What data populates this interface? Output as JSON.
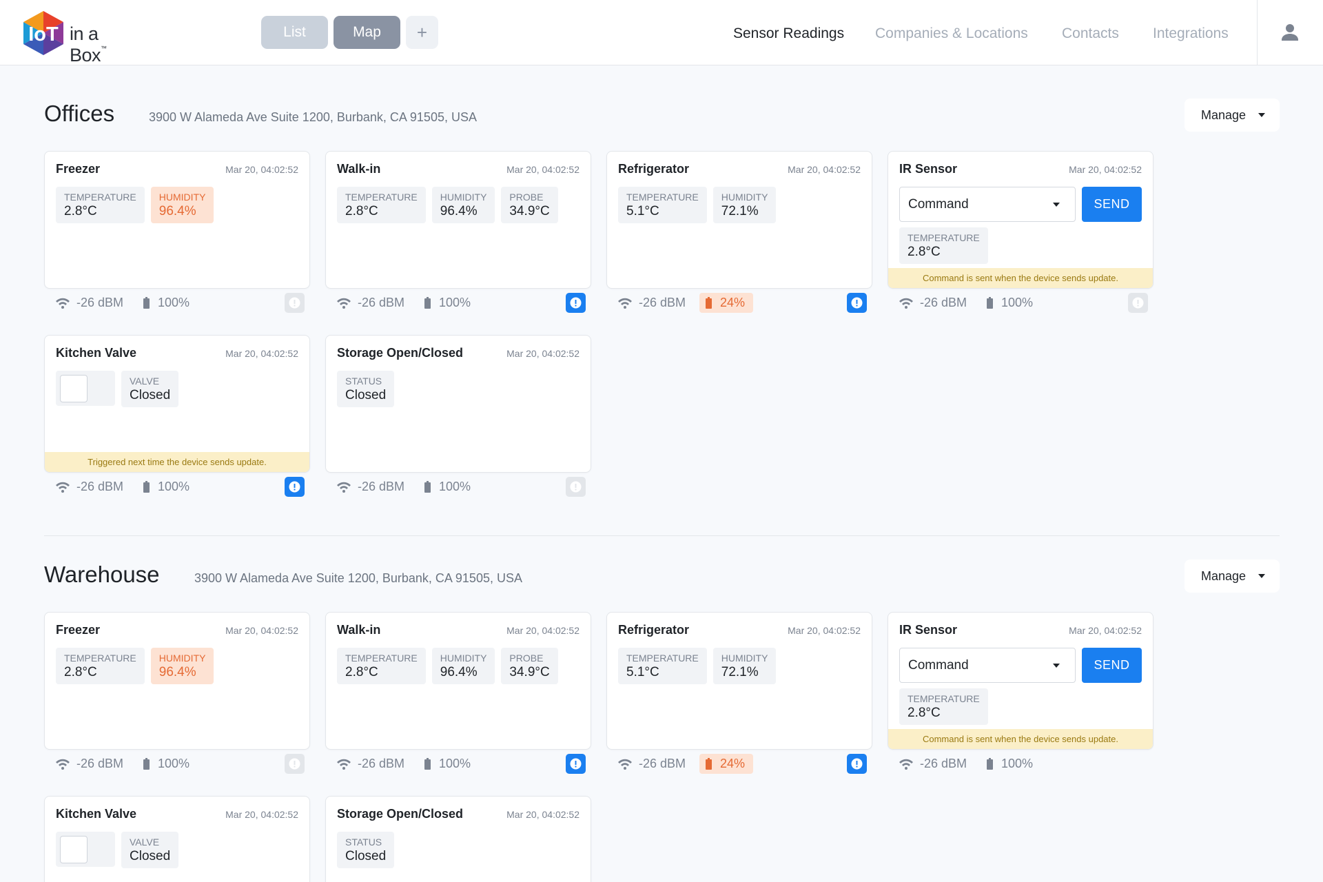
{
  "app": {
    "logo_word": "in a Box",
    "logo_tm": "™"
  },
  "view_toggle": {
    "list": "List",
    "map": "Map",
    "add": "+"
  },
  "nav": [
    "Sensor Readings",
    "Companies & Locations",
    "Contacts",
    "Integrations"
  ],
  "colors": {
    "primary": "#1a7ff0",
    "alert": "#e56a34",
    "notice_bg": "#fbefc8"
  },
  "manage_label": "Manage",
  "sections": [
    {
      "title": "Offices",
      "address": "3900 W Alameda Ave Suite 1200, Burbank, CA 91505, USA",
      "cards": [
        {
          "title": "Freezer",
          "time": "Mar 20, 04:02:52",
          "metrics": [
            {
              "label": "TEMPERATURE",
              "value": "2.8°C"
            },
            {
              "label": "HUMIDITY",
              "value": "96.4%",
              "alert": true
            }
          ],
          "signal": "-26 dBM",
          "battery": "100%",
          "status_active": false
        },
        {
          "title": "Walk-in",
          "time": "Mar 20, 04:02:52",
          "metrics": [
            {
              "label": "TEMPERATURE",
              "value": "2.8°C"
            },
            {
              "label": "HUMIDITY",
              "value": "96.4%"
            },
            {
              "label": "PROBE",
              "value": "34.9°C"
            }
          ],
          "signal": "-26 dBM",
          "battery": "100%",
          "status_active": true
        },
        {
          "title": "Refrigerator",
          "time": "Mar 20, 04:02:52",
          "metrics": [
            {
              "label": "TEMPERATURE",
              "value": "5.1°C"
            },
            {
              "label": "HUMIDITY",
              "value": "72.1%"
            }
          ],
          "signal": "-26 dBM",
          "battery": "24%",
          "battery_low": true,
          "status_active": true
        },
        {
          "title": "IR Sensor",
          "time": "Mar 20, 04:02:52",
          "command_placeholder": "Command",
          "send_label": "SEND",
          "metrics": [
            {
              "label": "TEMPERATURE",
              "value": "2.8°C"
            }
          ],
          "notice": "Command is sent when the device sends update.",
          "signal": "-26 dBM",
          "battery": "100%",
          "status_active": false
        },
        {
          "title": "Kitchen Valve",
          "time": "Mar 20, 04:02:52",
          "valve": {
            "label": "VALVE",
            "value": "Closed"
          },
          "notice": "Triggered next time the device sends update.",
          "signal": "-26 dBM",
          "battery": "100%",
          "status_active": true
        },
        {
          "title": "Storage Open/Closed",
          "time": "Mar 20, 04:02:52",
          "metrics": [
            {
              "label": "STATUS",
              "value": "Closed"
            }
          ],
          "signal": "-26 dBM",
          "battery": "100%",
          "status_active": false
        }
      ]
    },
    {
      "title": "Warehouse",
      "address": "3900 W Alameda Ave Suite 1200, Burbank, CA 91505, USA",
      "cards": [
        {
          "title": "Freezer",
          "time": "Mar 20, 04:02:52",
          "metrics": [
            {
              "label": "TEMPERATURE",
              "value": "2.8°C"
            },
            {
              "label": "HUMIDITY",
              "value": "96.4%",
              "alert": true
            }
          ],
          "signal": "-26 dBM",
          "battery": "100%",
          "status_active": false
        },
        {
          "title": "Walk-in",
          "time": "Mar 20, 04:02:52",
          "metrics": [
            {
              "label": "TEMPERATURE",
              "value": "2.8°C"
            },
            {
              "label": "HUMIDITY",
              "value": "96.4%"
            },
            {
              "label": "PROBE",
              "value": "34.9°C"
            }
          ],
          "signal": "-26 dBM",
          "battery": "100%",
          "status_active": true
        },
        {
          "title": "Refrigerator",
          "time": "Mar 20, 04:02:52",
          "metrics": [
            {
              "label": "TEMPERATURE",
              "value": "5.1°C"
            },
            {
              "label": "HUMIDITY",
              "value": "72.1%"
            }
          ],
          "signal": "-26 dBM",
          "battery": "24%",
          "battery_low": true,
          "status_active": true
        },
        {
          "title": "IR Sensor",
          "time": "Mar 20, 04:02:52",
          "command_placeholder": "Command",
          "send_label": "SEND",
          "metrics": [
            {
              "label": "TEMPERATURE",
              "value": "2.8°C"
            }
          ],
          "notice": "Command is sent when the device sends update.",
          "signal": "-26 dBM",
          "battery": "100%",
          "status_active": false
        },
        {
          "title": "Kitchen Valve",
          "time": "Mar 20, 04:02:52",
          "valve": {
            "label": "VALVE",
            "value": "Closed"
          }
        },
        {
          "title": "Storage Open/Closed",
          "time": "Mar 20, 04:02:52",
          "metrics": [
            {
              "label": "STATUS",
              "value": "Closed"
            }
          ]
        }
      ]
    }
  ]
}
